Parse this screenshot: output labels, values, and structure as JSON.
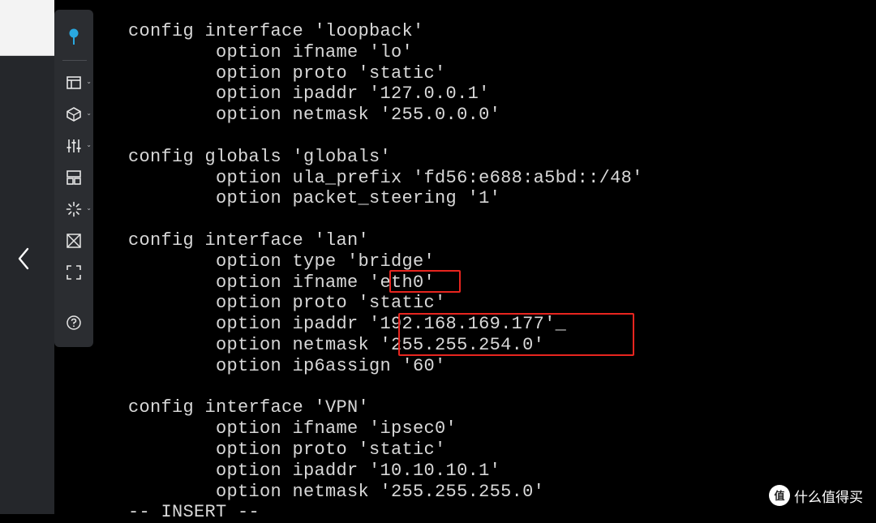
{
  "terminal": {
    "lines": [
      "config interface 'loopback'",
      "        option ifname 'lo'",
      "        option proto 'static'",
      "        option ipaddr '127.0.0.1'",
      "        option netmask '255.0.0.0'",
      "",
      "config globals 'globals'",
      "        option ula_prefix 'fd56:e688:a5bd::/48'",
      "        option packet_steering '1'",
      "",
      "config interface 'lan'",
      "        option type 'bridge'",
      "        option ifname 'eth0'",
      "        option proto 'static'",
      "        option ipaddr '192.168.169.177'_",
      "        option netmask '255.255.254.0'",
      "        option ip6assign '60'",
      "",
      "config interface 'VPN'",
      "        option ifname 'ipsec0'",
      "        option proto 'static'",
      "        option ipaddr '10.10.10.1'",
      "        option netmask '255.255.255.0'",
      "-- INSERT --"
    ]
  },
  "toolbar": {
    "items": [
      {
        "icon": "pin-icon"
      },
      {
        "icon": "layout-icon"
      },
      {
        "icon": "layers-icon"
      },
      {
        "icon": "sliders-icon"
      },
      {
        "icon": "grid-icon"
      },
      {
        "icon": "loading-icon"
      },
      {
        "icon": "shrink-icon"
      },
      {
        "icon": "fullscreen-icon"
      },
      {
        "icon": "help-icon"
      }
    ]
  },
  "watermark": {
    "text": "什么值得买"
  },
  "colors": {
    "highlight": "#e8251f",
    "accent": "#29a8e0",
    "terminal_text": "#d8d8d8"
  }
}
